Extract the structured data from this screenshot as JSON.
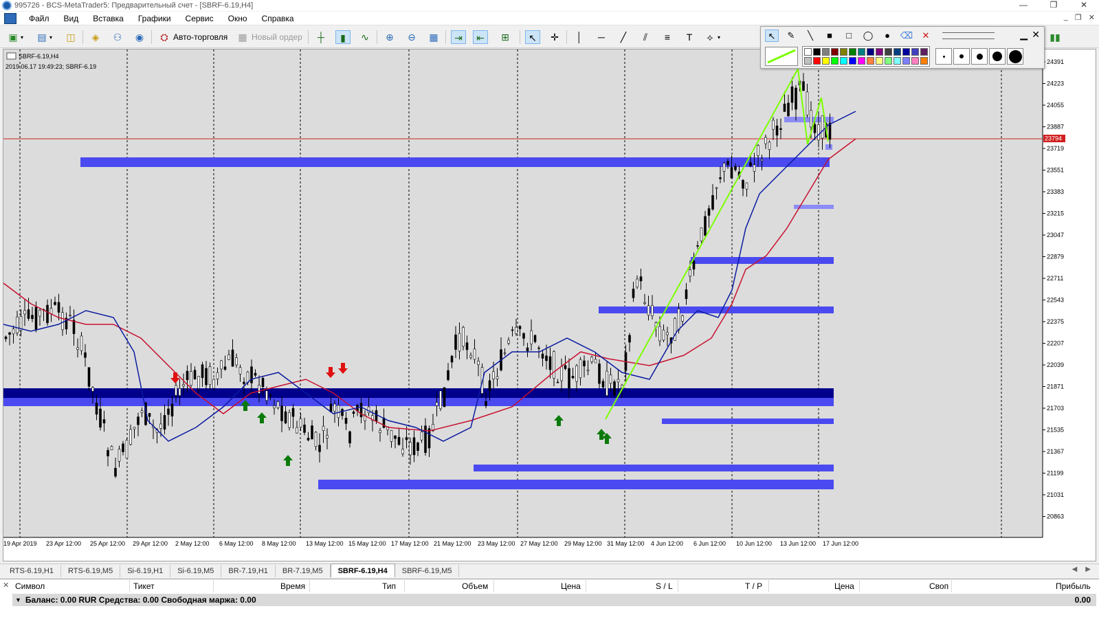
{
  "window": {
    "title": "995726 - BCS-MetaTrader5: Предварительный счет - [SBRF-6.19,H4]",
    "controls": [
      "—",
      "❐",
      "✕"
    ]
  },
  "menu": {
    "items": [
      "Файл",
      "Вид",
      "Вставка",
      "Графики",
      "Сервис",
      "Окно",
      "Справка"
    ],
    "mdi_controls": [
      "_",
      "❐",
      "✕"
    ]
  },
  "toolbar": {
    "autotrade_label": "Авто-торговля",
    "new_order_label": "Новый ордер",
    "text_tool": "T"
  },
  "chart": {
    "symbol_label": "SBRF-6.19,H4",
    "info_label": "2019.06.17 19:49:23; SBRF-6.19",
    "current_price": "23794",
    "price_ticks": [
      "24391",
      "24223",
      "24055",
      "23887",
      "23719",
      "23551",
      "23383",
      "23215",
      "23047",
      "22879",
      "22711",
      "22543",
      "22375",
      "22207",
      "22039",
      "21871",
      "21703",
      "21535",
      "21367",
      "21199",
      "21031",
      "20863"
    ],
    "time_ticks": [
      "19 Apr 2019",
      "23 Apr 12:00",
      "25 Apr 12:00",
      "29 Apr 12:00",
      "2 May 12:00",
      "6 May 12:00",
      "8 May 12:00",
      "13 May 12:00",
      "15 May 12:00",
      "17 May 12:00",
      "21 May 12:00",
      "23 May 12:00",
      "27 May 12:00",
      "29 May 12:00",
      "31 May 12:00",
      "4 Jun 12:00",
      "6 Jun 12:00",
      "10 Jun 12:00",
      "13 Jun 12:00",
      "17 Jun 12:00"
    ],
    "colors": {
      "background": "#ffffff",
      "candle": "#000000",
      "ma_fast": "#0a1aa0",
      "ma_slow": "#c8102e",
      "zone_dark": "#00008b",
      "zone_mid": "#4a4af0",
      "zone_light": "#8c8cf5",
      "trendline": "#7cff00",
      "price_line": "#d02020",
      "buy_arrow": "#0a7a0a",
      "sell_arrow": "#e01010"
    }
  },
  "tabs": {
    "items": [
      "RTS-6.19,H1",
      "RTS-6.19,M5",
      "Si-6.19,H1",
      "Si-6.19,M5",
      "BR-7.19,H1",
      "BR-7.19,M5",
      "SBRF-6.19,H4",
      "SBRF-6.19,M5"
    ],
    "active_index": 6
  },
  "terminal": {
    "columns": [
      "Символ",
      "Тикет",
      "Время",
      "Тип",
      "Объем",
      "Цена",
      "S / L",
      "T / P",
      "Цена",
      "Своп",
      "Прибыль"
    ],
    "balance_text": "Баланс: 0.00 RUR  Средства: 0.00  Свободная маржа: 0.00",
    "profit_total": "0.00"
  }
}
